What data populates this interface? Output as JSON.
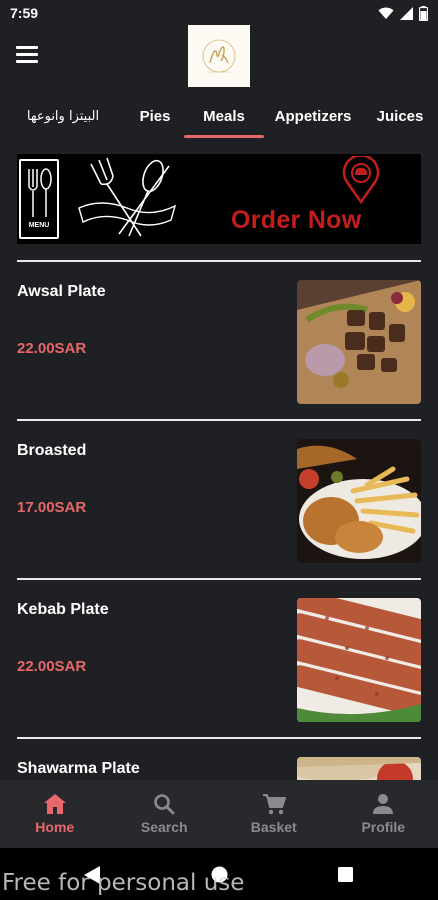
{
  "status_bar": {
    "time": "7:59"
  },
  "header": {
    "logo_alt": "restaurant-logo"
  },
  "tabs": [
    {
      "label": "البيتزا وانوعها",
      "active": false
    },
    {
      "label": "Pies",
      "active": false
    },
    {
      "label": "Meals",
      "active": true
    },
    {
      "label": "Appetizers",
      "active": false
    },
    {
      "label": "Juices",
      "active": false
    }
  ],
  "banner": {
    "menu_label": "MENU",
    "cta": "Order Now"
  },
  "items": [
    {
      "name": "Awsal Plate",
      "price": "22.00SAR"
    },
    {
      "name": "Broasted",
      "price": "17.00SAR"
    },
    {
      "name": "Kebab Plate",
      "price": "22.00SAR"
    },
    {
      "name": "Shawarma Plate",
      "price": ""
    }
  ],
  "bottom_nav": [
    {
      "label": "Home",
      "icon": "home-icon",
      "active": true
    },
    {
      "label": "Search",
      "icon": "search-icon",
      "active": false
    },
    {
      "label": "Basket",
      "icon": "cart-icon",
      "active": false
    },
    {
      "label": "Profile",
      "icon": "person-icon",
      "active": false
    }
  ],
  "watermark": "Free for personal use",
  "colors": {
    "accent": "#e8676a",
    "background": "#1f2023",
    "nav_background": "#28292c",
    "order_now": "#c21e1e"
  }
}
